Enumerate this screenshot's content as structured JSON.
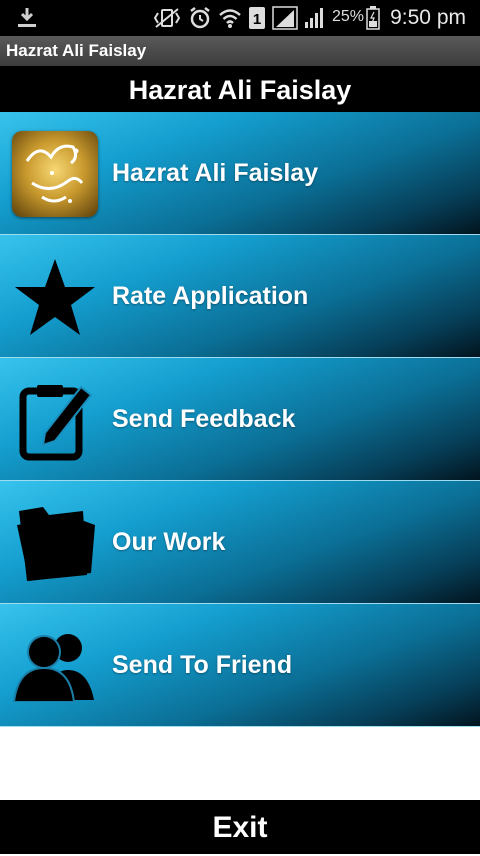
{
  "status_bar": {
    "battery_percent": "25%",
    "time": "9:50 pm",
    "icons": [
      "download-icon",
      "mute-icon",
      "vibrate-icon",
      "alarm-icon",
      "wifi-icon",
      "sim-icon",
      "signal-icon",
      "signal-icon",
      "battery-icon"
    ]
  },
  "app": {
    "title_bar": "Hazrat Ali Faislay",
    "header": "Hazrat Ali Faislay"
  },
  "menu": {
    "items": [
      {
        "label": "Hazrat Ali Faislay",
        "icon": "app-logo"
      },
      {
        "label": "Rate Application",
        "icon": "star-icon"
      },
      {
        "label": "Send Feedback",
        "icon": "edit-icon"
      },
      {
        "label": "Our Work",
        "icon": "folder-icon"
      },
      {
        "label": "Send To Friend",
        "icon": "users-icon"
      }
    ]
  },
  "footer": {
    "exit_label": "Exit"
  },
  "colors": {
    "menu_light": "#37c3ec",
    "menu_dark": "#02141e",
    "bar_background": "#000000"
  }
}
